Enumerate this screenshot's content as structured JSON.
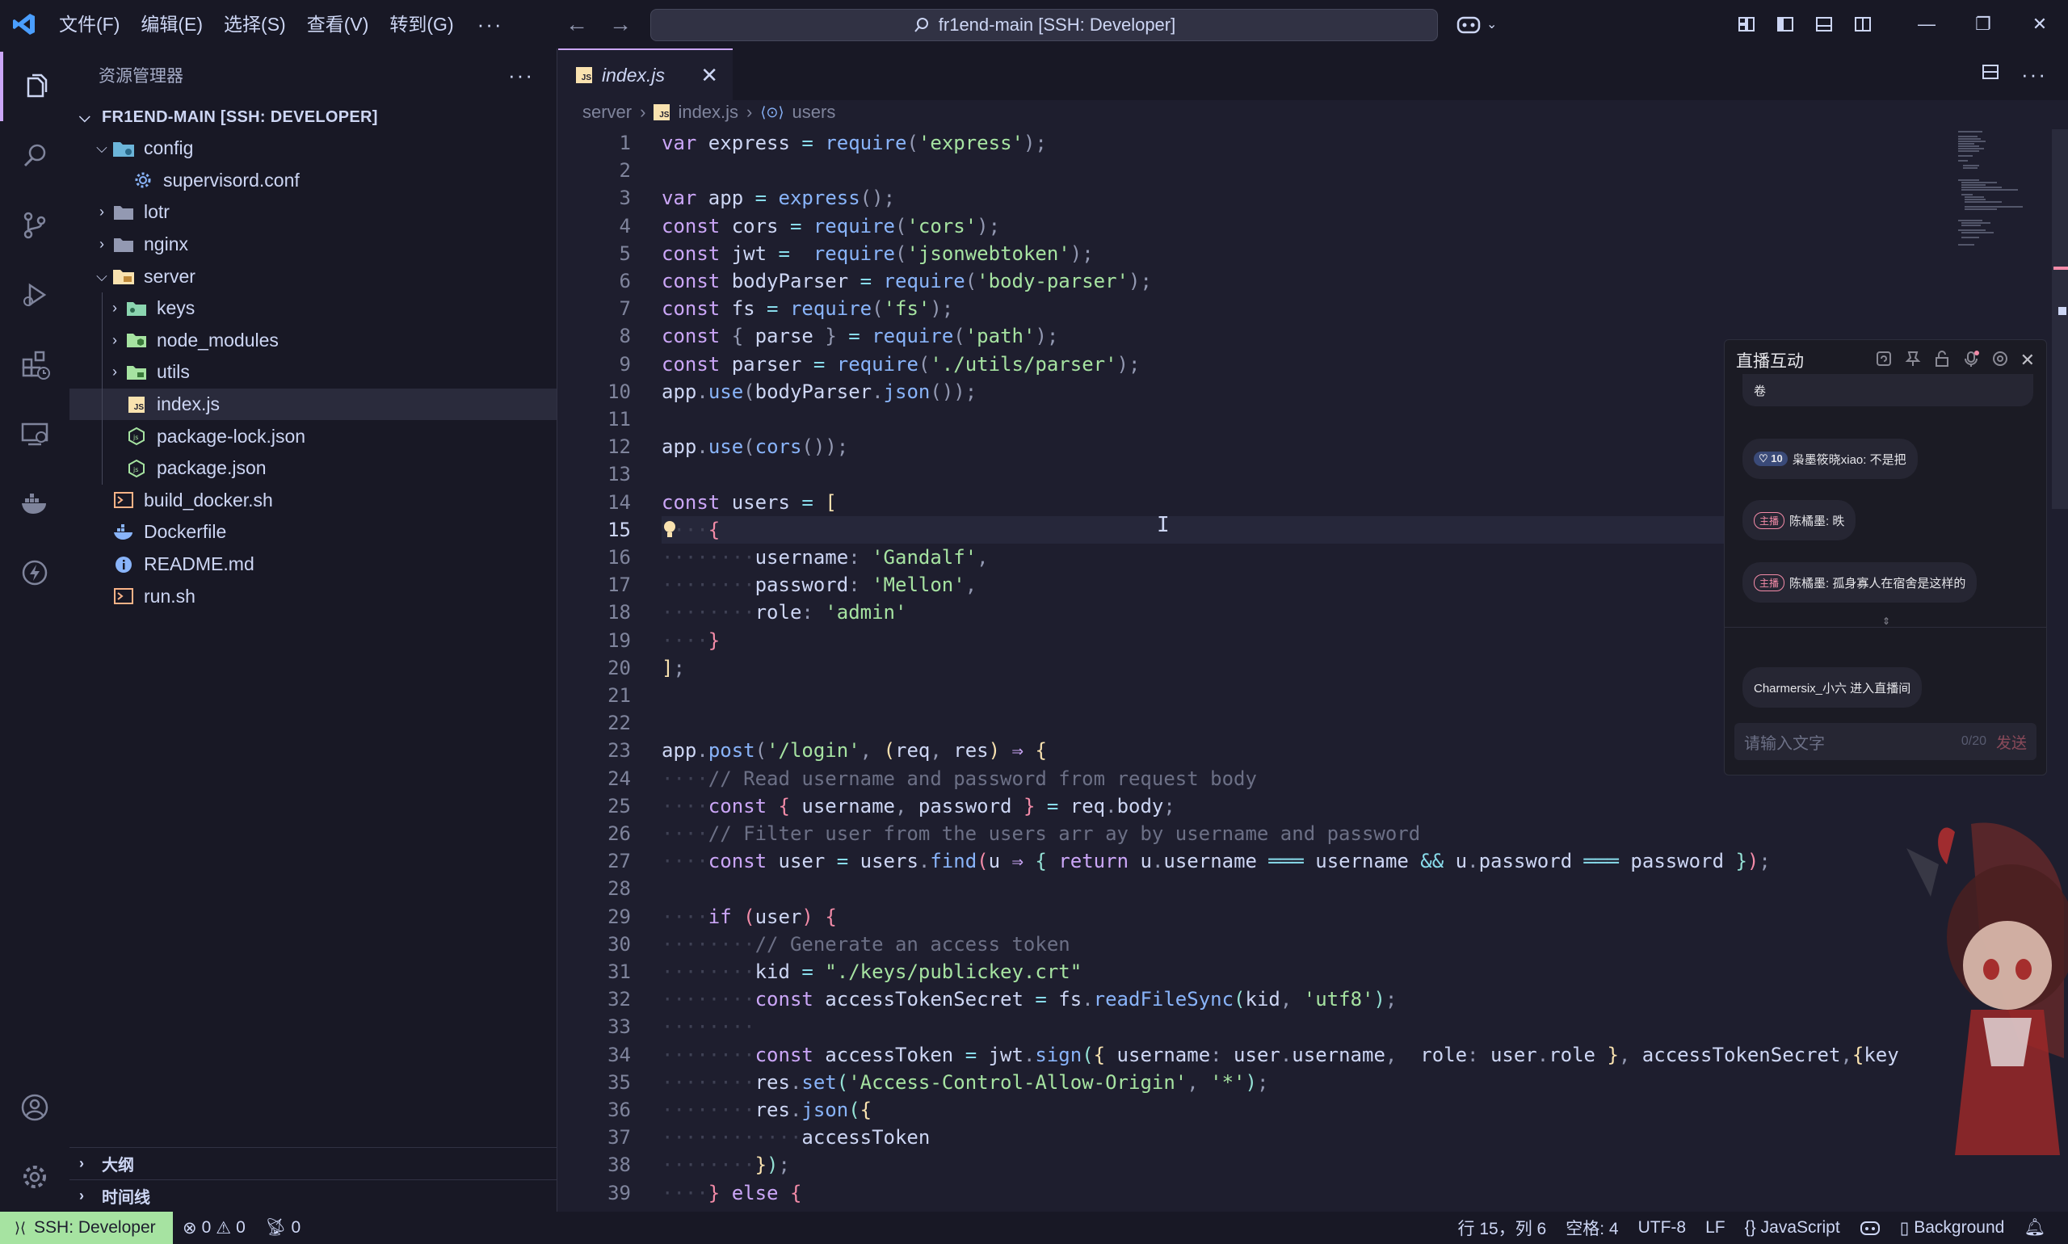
{
  "titlebar": {
    "menus": [
      "文件(F)",
      "编辑(E)",
      "选择(S)",
      "查看(V)",
      "转到(G)"
    ],
    "more": "···",
    "command_center": "fr1end-main [SSH: Developer]"
  },
  "sidebar": {
    "title": "资源管理器",
    "root": "FR1END-MAIN [SSH: DEVELOPER]",
    "items": [
      {
        "label": "config",
        "icon": "config-folder-icon"
      },
      {
        "label": "supervisord.conf",
        "icon": "gear-file-icon"
      },
      {
        "label": "lotr",
        "icon": "folder-icon"
      },
      {
        "label": "nginx",
        "icon": "folder-icon"
      },
      {
        "label": "server",
        "icon": "server-folder-icon"
      },
      {
        "label": "keys",
        "icon": "keys-folder-icon"
      },
      {
        "label": "node_modules",
        "icon": "node-folder-icon"
      },
      {
        "label": "utils",
        "icon": "utils-folder-icon"
      },
      {
        "label": "index.js",
        "icon": "js-file-icon"
      },
      {
        "label": "package-lock.json",
        "icon": "node-file-icon"
      },
      {
        "label": "package.json",
        "icon": "node-file-icon"
      },
      {
        "label": "build_docker.sh",
        "icon": "shell-file-icon"
      },
      {
        "label": "Dockerfile",
        "icon": "docker-file-icon"
      },
      {
        "label": "README.md",
        "icon": "info-file-icon"
      },
      {
        "label": "run.sh",
        "icon": "shell-file-icon"
      }
    ],
    "outline": "大纲",
    "timeline": "时间线"
  },
  "editor": {
    "tab": "index.js",
    "breadcrumb": [
      "server",
      "index.js",
      "users"
    ],
    "current_line": 15
  },
  "livechat": {
    "title": "直播互动",
    "top_fragment": "卷",
    "messages": [
      {
        "badge": "10",
        "text": "枭墨筱晓xiao: 不是把"
      },
      {
        "badge": "主播",
        "text": "陈橘墨: 昳"
      },
      {
        "badge": "主播",
        "text": "陈橘墨: 孤身寡人在宿舍是这样的"
      },
      {
        "badge": "",
        "text": "Charmersix_小六 进入直播间"
      }
    ],
    "input_placeholder": "请输入文字",
    "input_count": "0/20",
    "send": "发送"
  },
  "statusbar": {
    "remote": "SSH: Developer",
    "errors": "0",
    "warnings": "0",
    "ports": "0",
    "position": "行 15，列 6",
    "spaces": "空格: 4",
    "encoding": "UTF-8",
    "eol": "LF",
    "language": "JavaScript",
    "background": "Background"
  },
  "colors": {
    "accent": "#cba6f7",
    "remote_bg": "#a6e3a1",
    "js_yellow": "#f9e2af"
  }
}
